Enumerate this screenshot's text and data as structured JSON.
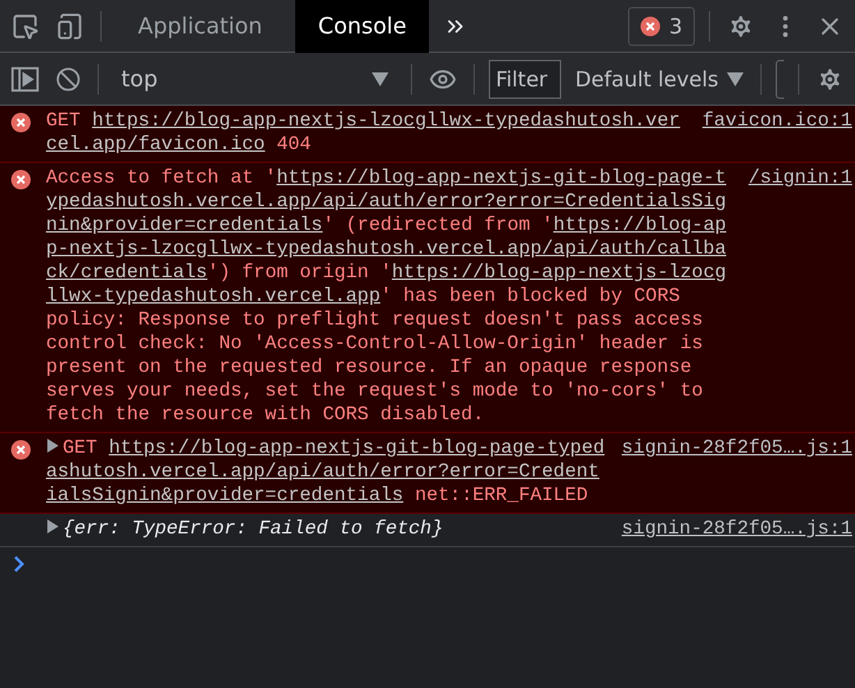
{
  "tabs": [
    {
      "label": "Application",
      "selected": false
    },
    {
      "label": "Console",
      "selected": true
    }
  ],
  "error_count": "3",
  "context": "top",
  "filter": {
    "placeholder": "Filter"
  },
  "levels": "Default levels",
  "messages": [
    {
      "kind": "error",
      "expandable": false,
      "source": "favicon.ico:1",
      "segments": [
        {
          "link": false,
          "text": "GET "
        },
        {
          "link": true,
          "text": "https://blog-app-nextjs-lzocgllwx-typedashutosh.vercel.app/favicon.ico"
        },
        {
          "link": false,
          "text": " 404"
        }
      ]
    },
    {
      "kind": "error",
      "expandable": false,
      "source": "/signin:1",
      "segments": [
        {
          "link": false,
          "text": "Access to fetch at '"
        },
        {
          "link": true,
          "text": "https://blog-app-nextjs-git-blog-page-typedashutosh.vercel.app/api/auth/error?error=CredentialsSignin&provider=credentials"
        },
        {
          "link": false,
          "text": "' (redirected from '"
        },
        {
          "link": true,
          "text": "https://blog-app-nextjs-lzocgllwx-typedashutosh.vercel.app/api/auth/callback/credentials"
        },
        {
          "link": false,
          "text": "') from origin '"
        },
        {
          "link": true,
          "text": "https://blog-app-nextjs-lzocgllwx-typedashutosh.vercel.app"
        },
        {
          "link": false,
          "text": "' has been blocked by CORS policy: Response to preflight request doesn't pass access control check: No 'Access-Control-Allow-Origin' header is present on the requested resource. If an opaque response serves your needs, set the request's mode to 'no-cors' to fetch the resource with CORS disabled."
        }
      ]
    },
    {
      "kind": "error",
      "expandable": true,
      "source": "signin-28f2f05….js:1",
      "segments": [
        {
          "link": false,
          "text": "GET "
        },
        {
          "link": true,
          "text": "https://blog-app-nextjs-git-blog-page-typedashutosh.vercel.app/api/auth/error?error=CredentialsSignin&provider=credentials"
        },
        {
          "link": false,
          "text": " net::ERR_FAILED"
        }
      ]
    },
    {
      "kind": "log",
      "expandable": true,
      "source": "signin-28f2f05….js:1",
      "segments": [
        {
          "link": false,
          "text": "{err: TypeError: Failed to fetch}"
        }
      ]
    }
  ]
}
